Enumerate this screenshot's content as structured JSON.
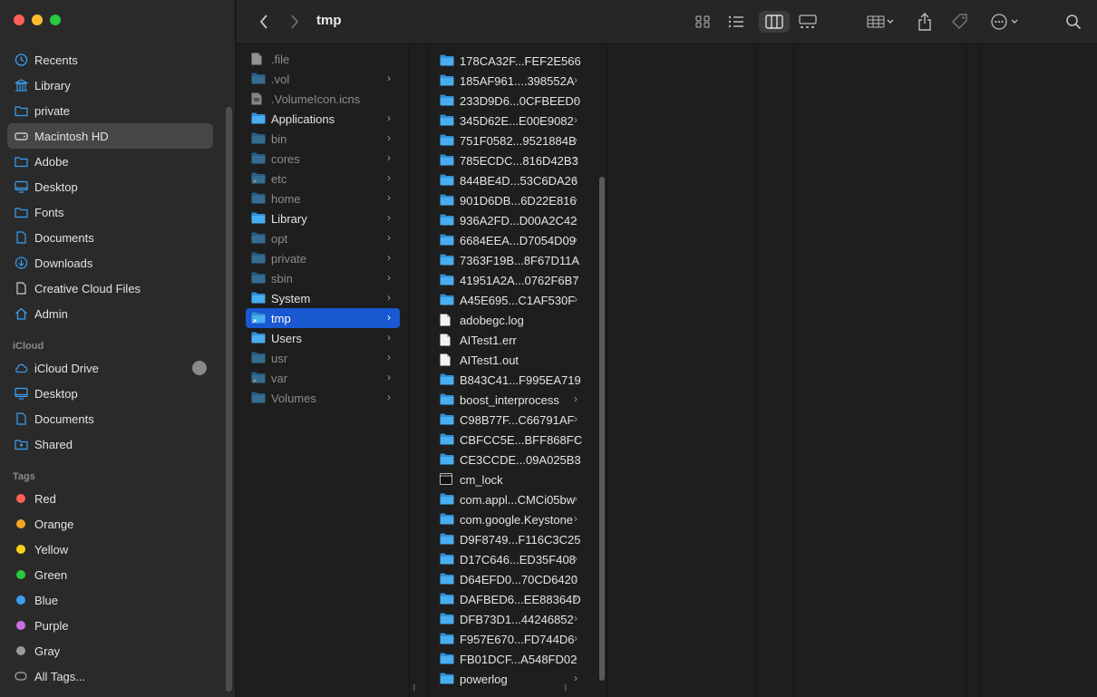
{
  "window": {
    "title": "tmp"
  },
  "sidebar": {
    "favorites": [
      {
        "label": "Recents",
        "icon": "clock-icon"
      },
      {
        "label": "Library",
        "icon": "library-icon"
      },
      {
        "label": "private",
        "icon": "folder-icon"
      },
      {
        "label": "Macintosh HD",
        "icon": "disk-icon",
        "selected": true
      },
      {
        "label": "Adobe",
        "icon": "folder-icon"
      },
      {
        "label": "Desktop",
        "icon": "desktop-icon"
      },
      {
        "label": "Fonts",
        "icon": "folder-icon"
      },
      {
        "label": "Documents",
        "icon": "document-icon"
      },
      {
        "label": "Downloads",
        "icon": "download-icon"
      },
      {
        "label": "Creative Cloud Files",
        "icon": "file-icon"
      },
      {
        "label": "Admin",
        "icon": "home-icon"
      }
    ],
    "icloud_heading": "iCloud",
    "icloud": [
      {
        "label": "iCloud Drive",
        "icon": "cloud-icon"
      },
      {
        "label": "Desktop",
        "icon": "desktop-icon"
      },
      {
        "label": "Documents",
        "icon": "document-icon"
      },
      {
        "label": "Shared",
        "icon": "shared-folder-icon"
      }
    ],
    "tags_heading": "Tags",
    "tags": [
      {
        "label": "Red",
        "color": "#ff5f57"
      },
      {
        "label": "Orange",
        "color": "#f5a623"
      },
      {
        "label": "Yellow",
        "color": "#f7d31c"
      },
      {
        "label": "Green",
        "color": "#29c940"
      },
      {
        "label": "Blue",
        "color": "#3b9cf3"
      },
      {
        "label": "Purple",
        "color": "#c86fe0"
      },
      {
        "label": "Gray",
        "color": "#9a9a9c"
      }
    ],
    "all_tags": "All Tags..."
  },
  "column1": [
    {
      "name": ".file",
      "kind": "file",
      "dim": true,
      "chevron": false
    },
    {
      "name": ".vol",
      "kind": "folder",
      "dim": true,
      "chevron": true
    },
    {
      "name": ".VolumeIcon.icns",
      "kind": "icns",
      "dim": true,
      "chevron": false
    },
    {
      "name": "Applications",
      "kind": "folder",
      "dim": false,
      "chevron": true
    },
    {
      "name": "bin",
      "kind": "folder",
      "dim": true,
      "chevron": true
    },
    {
      "name": "cores",
      "kind": "folder",
      "dim": true,
      "chevron": true
    },
    {
      "name": "etc",
      "kind": "alias",
      "dim": true,
      "chevron": true
    },
    {
      "name": "home",
      "kind": "folder",
      "dim": true,
      "chevron": true
    },
    {
      "name": "Library",
      "kind": "folder",
      "dim": false,
      "chevron": true
    },
    {
      "name": "opt",
      "kind": "folder",
      "dim": true,
      "chevron": true
    },
    {
      "name": "private",
      "kind": "folder",
      "dim": true,
      "chevron": true
    },
    {
      "name": "sbin",
      "kind": "folder",
      "dim": true,
      "chevron": true
    },
    {
      "name": "System",
      "kind": "folder",
      "dim": false,
      "chevron": true
    },
    {
      "name": "tmp",
      "kind": "alias",
      "dim": false,
      "chevron": true,
      "selected": true
    },
    {
      "name": "Users",
      "kind": "folder",
      "dim": false,
      "chevron": true
    },
    {
      "name": "usr",
      "kind": "folder",
      "dim": true,
      "chevron": true
    },
    {
      "name": "var",
      "kind": "alias",
      "dim": true,
      "chevron": true
    },
    {
      "name": "Volumes",
      "kind": "folder",
      "dim": true,
      "chevron": true
    }
  ],
  "column2": [
    {
      "name": "178CA32F...FEF2E566",
      "kind": "folder",
      "chevron": true
    },
    {
      "name": "185AF961....398552A",
      "kind": "folder",
      "chevron": true
    },
    {
      "name": "233D9D6...0CFBEED0",
      "kind": "folder",
      "chevron": true
    },
    {
      "name": "345D62E...E00E9082",
      "kind": "folder",
      "chevron": true
    },
    {
      "name": "751F0582...9521884B",
      "kind": "folder",
      "chevron": true
    },
    {
      "name": "785ECDC...816D42B3",
      "kind": "folder",
      "chevron": true
    },
    {
      "name": "844BE4D...53C6DA26",
      "kind": "folder",
      "chevron": true
    },
    {
      "name": "901D6DB...6D22E816",
      "kind": "folder",
      "chevron": true
    },
    {
      "name": "936A2FD...D00A2C42",
      "kind": "folder",
      "chevron": true
    },
    {
      "name": "6684EEA...D7054D09",
      "kind": "folder",
      "chevron": true
    },
    {
      "name": "7363F19B...8F67D11A",
      "kind": "folder",
      "chevron": true
    },
    {
      "name": "41951A2A...0762F6B7",
      "kind": "folder",
      "chevron": true
    },
    {
      "name": "A45E695...C1AF530F",
      "kind": "folder",
      "chevron": true
    },
    {
      "name": "adobegc.log",
      "kind": "file",
      "chevron": false
    },
    {
      "name": "AITest1.err",
      "kind": "file",
      "chevron": false
    },
    {
      "name": "AITest1.out",
      "kind": "file",
      "chevron": false
    },
    {
      "name": "B843C41...F995EA719",
      "kind": "folder",
      "chevron": true
    },
    {
      "name": "boost_interprocess",
      "kind": "folder",
      "chevron": true
    },
    {
      "name": "C98B77F...C66791AF",
      "kind": "folder",
      "chevron": true
    },
    {
      "name": "CBFCC5E...BFF868FC",
      "kind": "folder",
      "chevron": true
    },
    {
      "name": "CE3CCDE...09A025B3",
      "kind": "folder",
      "chevron": true
    },
    {
      "name": "cm_lock",
      "kind": "exec",
      "chevron": false
    },
    {
      "name": "com.appl...CMCi05bw",
      "kind": "folder",
      "chevron": true
    },
    {
      "name": "com.google.Keystone",
      "kind": "folder",
      "chevron": true
    },
    {
      "name": "D9F8749...F116C3C25",
      "kind": "folder",
      "chevron": true
    },
    {
      "name": "D17C646...ED35F408",
      "kind": "folder",
      "chevron": true
    },
    {
      "name": "D64EFD0...70CD6420",
      "kind": "folder",
      "chevron": true
    },
    {
      "name": "DAFBED6...EE88364D",
      "kind": "folder",
      "chevron": true
    },
    {
      "name": "DFB73D1...44246852",
      "kind": "folder",
      "chevron": true
    },
    {
      "name": "F957E670...FD744D6",
      "kind": "folder",
      "chevron": true
    },
    {
      "name": "FB01DCF...A548FD02",
      "kind": "folder",
      "chevron": true
    },
    {
      "name": "powerlog",
      "kind": "folder",
      "chevron": true
    }
  ],
  "colors": {
    "accent": "#1858d0",
    "folder": "#3aa5e8"
  }
}
